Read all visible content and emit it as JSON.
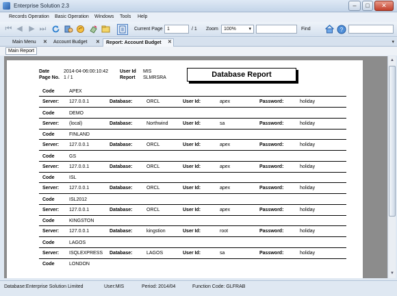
{
  "window": {
    "title": "Enterprise Solution  2.3",
    "minimize": "–",
    "maximize": "□",
    "close": "✕"
  },
  "menu": [
    "Records Operation",
    "Basic Operation",
    "Windows",
    "Tools",
    "Help"
  ],
  "toolbar": {
    "current_page_label": "Current Page",
    "current_page_value": "1",
    "page_total": "/ 1",
    "zoom_label": "Zoom",
    "zoom_value": "100%",
    "zoom_arrow": "▾",
    "find_value": "",
    "find_label": "Find",
    "icons": [
      "first-page-icon",
      "previous-page-icon",
      "next-page-icon",
      "last-page-icon",
      "refresh-icon",
      "pan-hand-icon",
      "zoom-hand-icon",
      "print-icon",
      "export-folder-icon",
      "page-layout-icon",
      "home-icon",
      "help-icon"
    ]
  },
  "tabs": [
    {
      "label": "Main Menu",
      "close": "✕"
    },
    {
      "label": "Account Budget",
      "close": "✕"
    },
    {
      "label": "Report: Account Budget",
      "close": "✕"
    }
  ],
  "tabs_scroll": "▾",
  "subtab": "Main Report",
  "report": {
    "date_label": "Date",
    "date_value": "2014-04-06:00:10:42",
    "page_no_label": "Page No.",
    "page_no_value": "1 / 1",
    "user_id_label": "User Id",
    "user_id_value": "MIS",
    "report_label": "Report",
    "report_value": "SLMRSRA",
    "title": "Database Report",
    "code_label": "Code",
    "server_label": "Server:",
    "database_label": "Database:",
    "userid_label": "User Id:",
    "password_label": "Password:",
    "entries": [
      {
        "code": "APEX",
        "server": "127.0.0.1",
        "database": "ORCL",
        "user_id": "apex",
        "password": "holiday"
      },
      {
        "code": "DEMO",
        "server": "(local)",
        "database": "Northwind",
        "user_id": "sa",
        "password": "holiday"
      },
      {
        "code": "FINLAND",
        "server": "127.0.0.1",
        "database": "ORCL",
        "user_id": "apex",
        "password": "holiday"
      },
      {
        "code": "GS",
        "server": "127.0.0.1",
        "database": "ORCL",
        "user_id": "apex",
        "password": "holiday"
      },
      {
        "code": "ISL",
        "server": "127.0.0.1",
        "database": "ORCL",
        "user_id": "apex",
        "password": "holiday"
      },
      {
        "code": "ISL2012",
        "server": "127.0.0.1",
        "database": "ORCL",
        "user_id": "apex",
        "password": "holiday"
      },
      {
        "code": "KINGSTON",
        "server": "127.0.0.1",
        "database": "kingstion",
        "user_id": "root",
        "password": "holiday"
      },
      {
        "code": "LAGOS",
        "server": "ISQLEXPRESS",
        "database": "LAGOS",
        "user_id": "sa",
        "password": "holiday"
      },
      {
        "code": "LONDON"
      }
    ]
  },
  "status": {
    "database": "Database:Enterprise Solution Limited",
    "user": "User:MIS",
    "period": "Period: 2014/04",
    "function_code": "Function Code:  GLFRAB"
  },
  "scroll": {
    "up": "▲",
    "down": "▼"
  },
  "colors": {
    "accent": "#2a5fa8",
    "viewer_bg": "#8c8c8c",
    "page_bg": "#ffffff"
  }
}
